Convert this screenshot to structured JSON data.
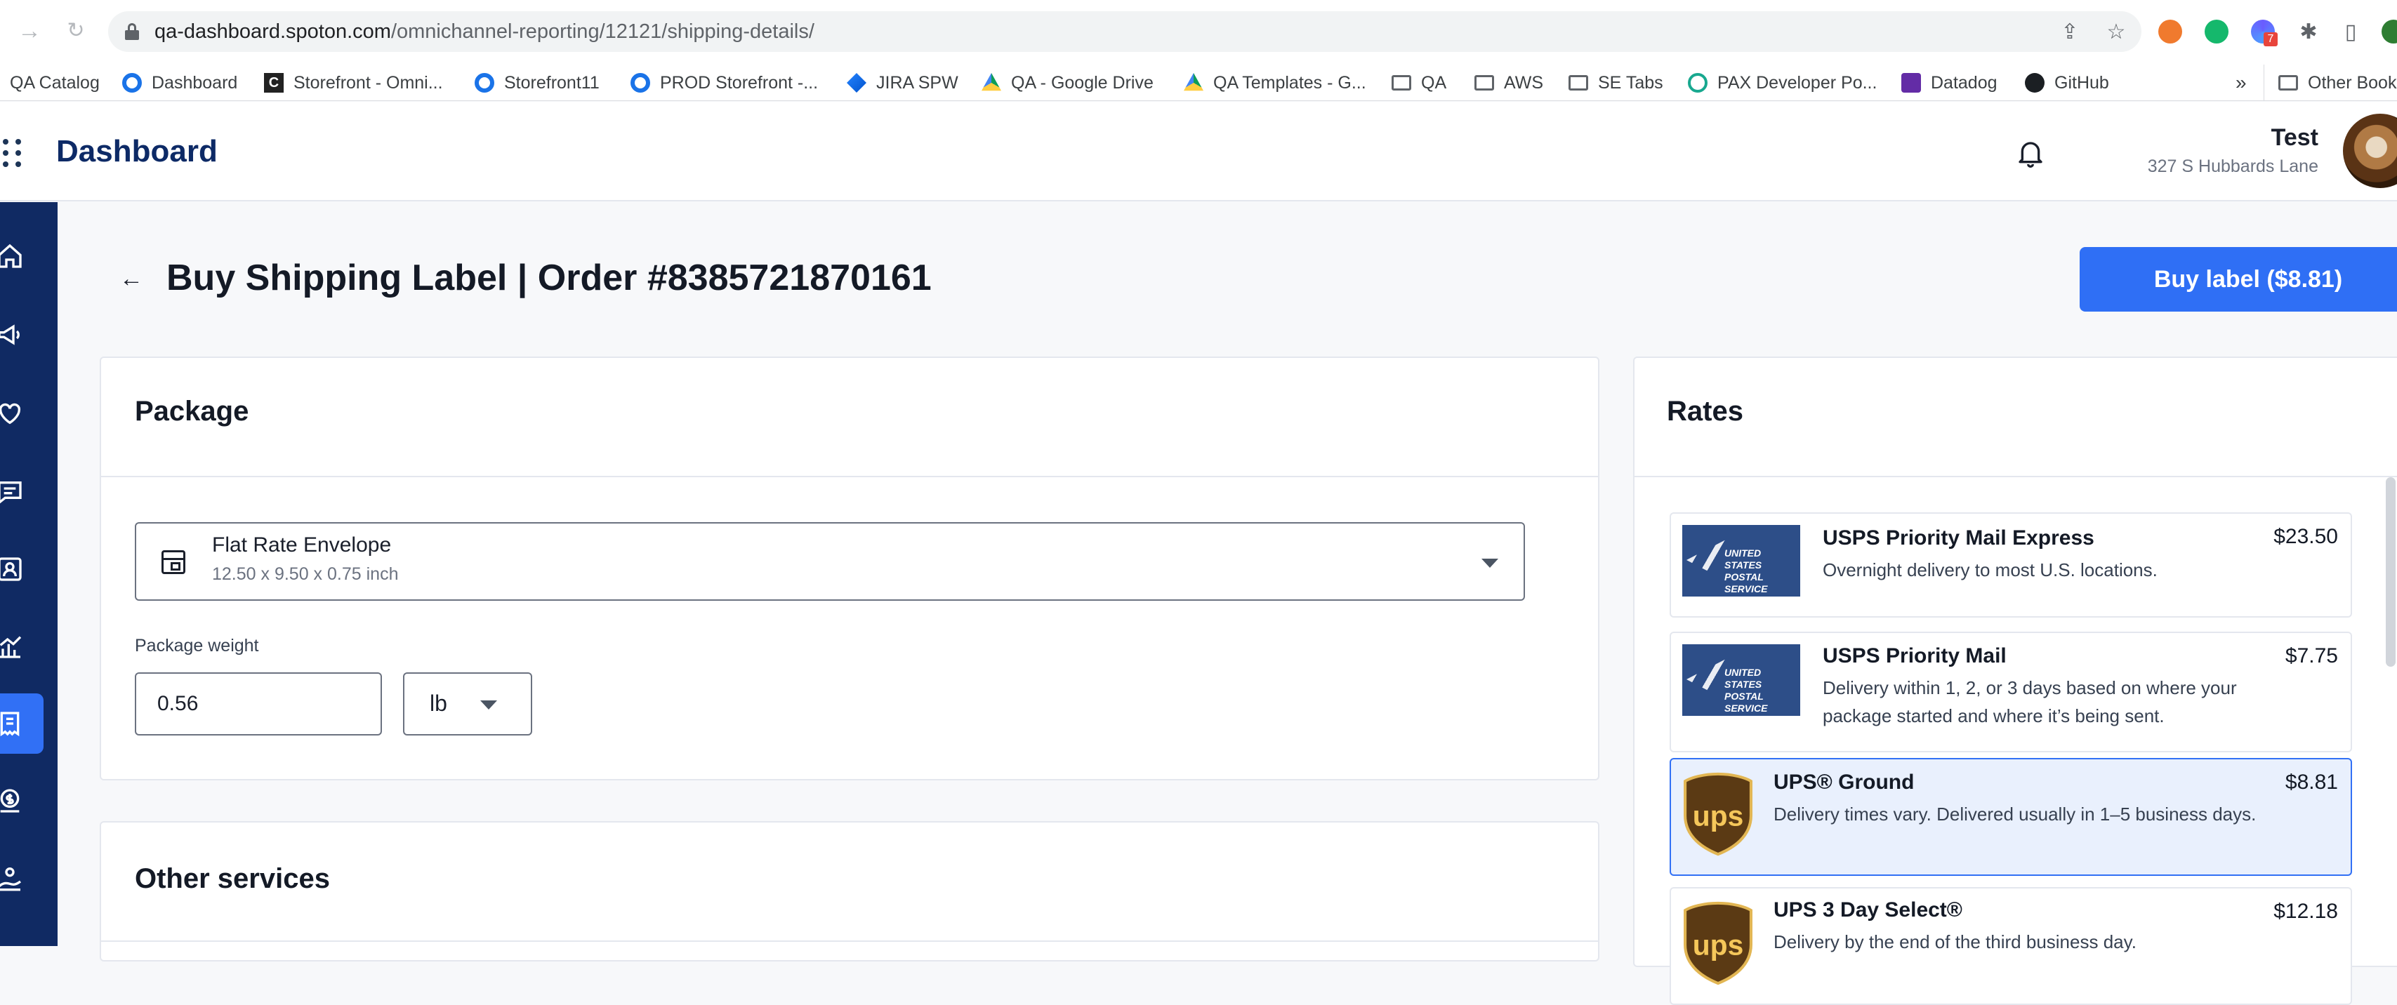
{
  "browser": {
    "url_host": "qa-dashboard.spoton.com",
    "url_path": "/omnichannel-reporting/12121/shipping-details/",
    "extension_badge": "7"
  },
  "bookmarks": [
    {
      "label": "QA Catalog",
      "icon": "none"
    },
    {
      "label": "Dashboard",
      "icon": "globe-icon"
    },
    {
      "label": "Storefront - Omni...",
      "icon": "c-icon"
    },
    {
      "label": "Storefront11",
      "icon": "globe-icon"
    },
    {
      "label": "PROD Storefront -...",
      "icon": "globe-icon"
    },
    {
      "label": "JIRA SPW",
      "icon": "jira-icon"
    },
    {
      "label": "QA - Google Drive",
      "icon": "drive-icon"
    },
    {
      "label": "QA Templates - G...",
      "icon": "drive-icon"
    },
    {
      "label": "QA",
      "icon": "folder-icon"
    },
    {
      "label": "AWS",
      "icon": "folder-icon"
    },
    {
      "label": "SE Tabs",
      "icon": "folder-icon"
    },
    {
      "label": "PAX Developer Po...",
      "icon": "pax-icon"
    },
    {
      "label": "Datadog",
      "icon": "datadog-icon"
    },
    {
      "label": "GitHub",
      "icon": "github-icon"
    }
  ],
  "bookmarks_overflow": "»",
  "other_bookmarks": "Other Bookm",
  "header": {
    "brand": "Dashboard",
    "user_name": "Test",
    "user_address": "327 S Hubbards Lane"
  },
  "page": {
    "title": "Buy Shipping Label | Order #8385721870161",
    "buy_label": "Buy label ($8.81)"
  },
  "package": {
    "title": "Package",
    "selected_package": "Flat Rate Envelope",
    "package_dimensions": "12.50 x 9.50 x 0.75 inch",
    "weight_label": "Package weight",
    "weight_value": "0.56",
    "weight_unit": "lb"
  },
  "other_services": {
    "title": "Other services"
  },
  "rates": {
    "title": "Rates",
    "items": [
      {
        "carrier": "usps",
        "name": "USPS Priority Mail Express",
        "description": "Overnight delivery to most U.S. locations.",
        "price": "$23.50",
        "selected": false
      },
      {
        "carrier": "usps",
        "name": "USPS Priority Mail",
        "description": "Delivery within 1, 2, or 3 days based on where your package started and where it’s being sent.",
        "price": "$7.75",
        "selected": false
      },
      {
        "carrier": "ups",
        "name": "UPS® Ground",
        "description": "Delivery times vary. Delivered usually in 1–5 business days.",
        "price": "$8.81",
        "selected": true
      },
      {
        "carrier": "ups",
        "name": "UPS 3 Day Select®",
        "description": "Delivery by the end of the third business day.",
        "price": "$12.18",
        "selected": false
      }
    ]
  },
  "usps_logo_text": "UNITED STATES POSTAL SERVICE",
  "ups_logo_text": "ups",
  "colors": {
    "primary": "#2f6ff5",
    "nav_bg": "#102a63",
    "selected_rate_bg": "#e9f0fd",
    "brand_text": "#0d2a66"
  }
}
